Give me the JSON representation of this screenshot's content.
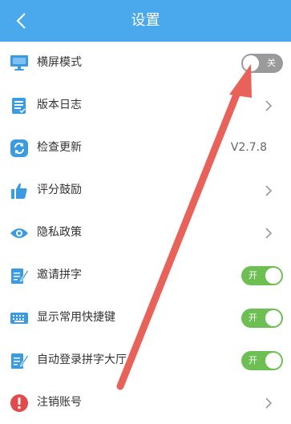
{
  "header": {
    "title": "设置",
    "back_icon": "chevron-left-icon",
    "background": "#4aa8ec"
  },
  "settings": [
    {
      "label": "横屏模式",
      "icon": "monitor-icon",
      "control": "toggle",
      "toggle_state": "off",
      "toggle_text": "关"
    },
    {
      "label": "版本日志",
      "icon": "document-log-icon",
      "control": "chevron"
    },
    {
      "label": "检查更新",
      "icon": "refresh-icon",
      "control": "value",
      "value": "V2.7.8"
    },
    {
      "label": "评分鼓励",
      "icon": "thumbs-up-icon",
      "control": "chevron"
    },
    {
      "label": "隐私政策",
      "icon": "eye-icon",
      "control": "chevron"
    },
    {
      "label": "邀请拼字",
      "icon": "edit-note-icon",
      "control": "toggle",
      "toggle_state": "on",
      "toggle_text": "开"
    },
    {
      "label": "显示常用快捷键",
      "icon": "keyboard-icon",
      "control": "toggle",
      "toggle_state": "on",
      "toggle_text": "开"
    },
    {
      "label": "自动登录拼字大厅",
      "icon": "edit-note-icon",
      "control": "toggle",
      "toggle_state": "on",
      "toggle_text": "开"
    },
    {
      "label": "注销账号",
      "icon": "warning-circle-icon",
      "control": "chevron"
    }
  ],
  "colors": {
    "accent_blue": "#3a9be0",
    "toggle_on": "#6dbf54",
    "toggle_off": "#9a9a9a",
    "annotation_arrow": "#e8625a",
    "warning_red": "#e24b4b"
  }
}
